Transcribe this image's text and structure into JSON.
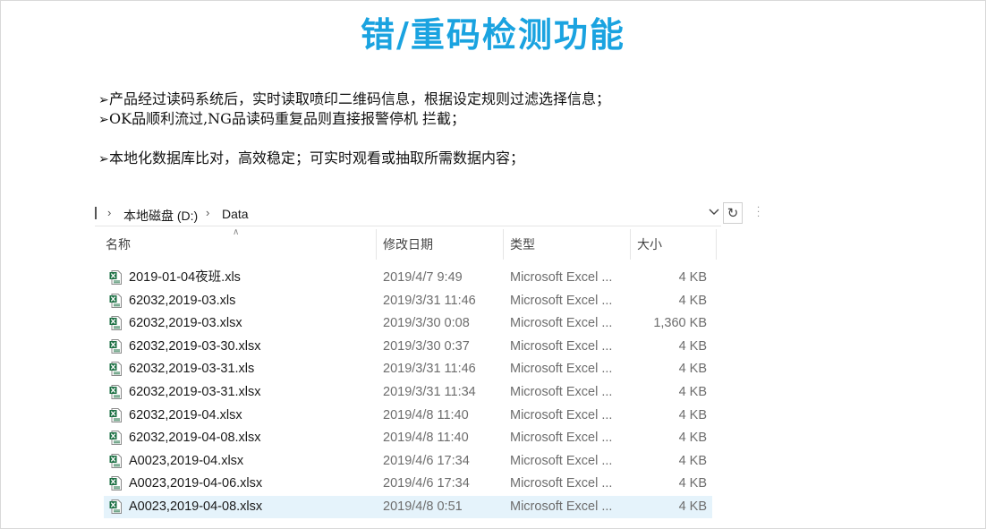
{
  "title": "错/重码检测功能",
  "bullets": [
    "产品经过读码系统后，实时读取喷印二维码信息，根据设定规则过滤选择信息；",
    "OK品顺利流过,NG品读码重复品则直接报警停机 拦截；",
    "本地化数据库比对，高效稳定；可实时观看或抽取所需数据内容；"
  ],
  "bullet_marker": "➢",
  "explorer": {
    "breadcrumb": [
      "本地磁盘 (D:)",
      "Data"
    ],
    "columns": {
      "name": "名称",
      "date": "修改日期",
      "type": "类型",
      "size": "大小"
    },
    "colors": {
      "selected_row": "#e5f3fb",
      "excel_green": "#1d7044"
    },
    "files": [
      {
        "name": "2019-01-04夜班.xls",
        "date": "2019/4/7 9:49",
        "type": "Microsoft Excel ...",
        "size": "4 KB",
        "icon": "excel-file-icon"
      },
      {
        "name": "62032,2019-03.xls",
        "date": "2019/3/31 11:46",
        "type": "Microsoft Excel ...",
        "size": "4 KB",
        "icon": "excel-file-icon"
      },
      {
        "name": "62032,2019-03.xlsx",
        "date": "2019/3/30 0:08",
        "type": "Microsoft Excel ...",
        "size": "1,360 KB",
        "icon": "excel-file-icon"
      },
      {
        "name": "62032,2019-03-30.xlsx",
        "date": "2019/3/30 0:37",
        "type": "Microsoft Excel ...",
        "size": "4 KB",
        "icon": "excel-file-icon"
      },
      {
        "name": "62032,2019-03-31.xls",
        "date": "2019/3/31 11:46",
        "type": "Microsoft Excel ...",
        "size": "4 KB",
        "icon": "excel-file-icon"
      },
      {
        "name": "62032,2019-03-31.xlsx",
        "date": "2019/3/31 11:34",
        "type": "Microsoft Excel ...",
        "size": "4 KB",
        "icon": "excel-file-icon"
      },
      {
        "name": "62032,2019-04.xlsx",
        "date": "2019/4/8 11:40",
        "type": "Microsoft Excel ...",
        "size": "4 KB",
        "icon": "excel-file-icon"
      },
      {
        "name": "62032,2019-04-08.xlsx",
        "date": "2019/4/8 11:40",
        "type": "Microsoft Excel ...",
        "size": "4 KB",
        "icon": "excel-file-icon"
      },
      {
        "name": "A0023,2019-04.xlsx",
        "date": "2019/4/6 17:34",
        "type": "Microsoft Excel ...",
        "size": "4 KB",
        "icon": "excel-file-icon"
      },
      {
        "name": "A0023,2019-04-06.xlsx",
        "date": "2019/4/6 17:34",
        "type": "Microsoft Excel ...",
        "size": "4 KB",
        "icon": "excel-file-icon"
      },
      {
        "name": "A0023,2019-04-08.xlsx",
        "date": "2019/4/8 0:51",
        "type": "Microsoft Excel ...",
        "size": "4 KB",
        "icon": "excel-file-icon",
        "selected": true
      }
    ]
  }
}
